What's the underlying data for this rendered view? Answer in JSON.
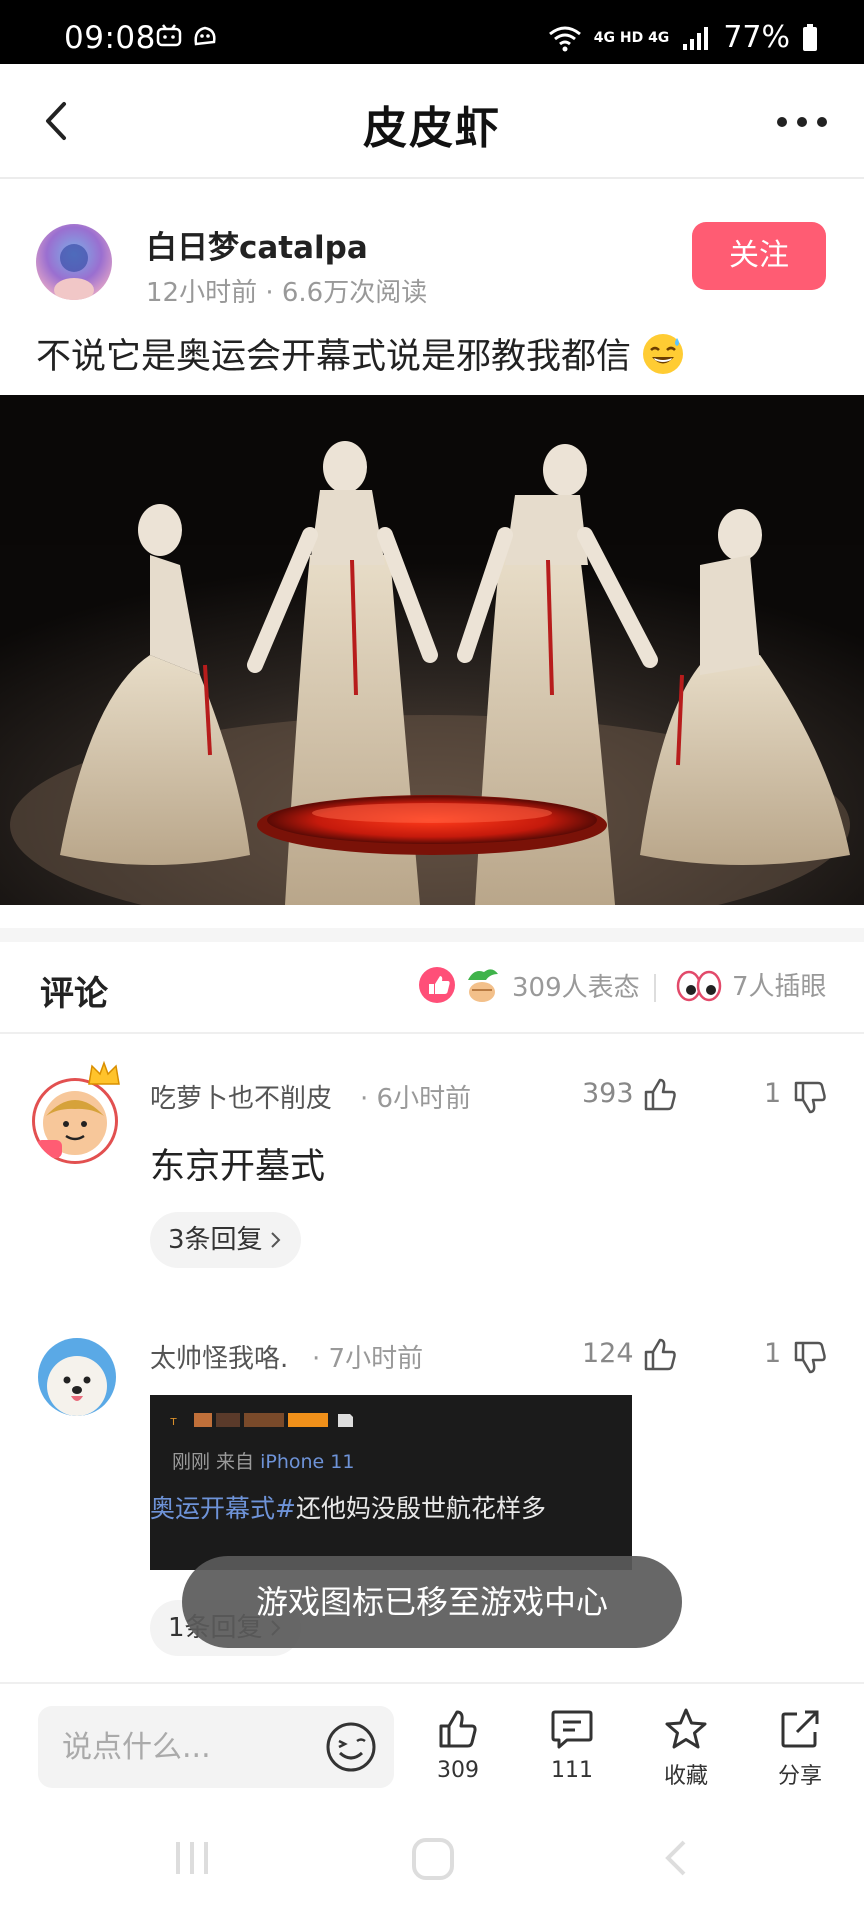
{
  "status_bar": {
    "time": "09:08",
    "net_label": "4G HD 4G",
    "battery": "77%"
  },
  "header": {
    "title": "皮皮虾"
  },
  "post": {
    "author": "白日梦catalpa",
    "meta": "12小时前 · 6.6万次阅读",
    "follow_label": "关注",
    "text": "不说它是奥运会开幕式说是邪教我都信"
  },
  "comments_section": {
    "title": "评论",
    "reactions": "309人表态",
    "eye_count": "7人插眼"
  },
  "comments": [
    {
      "user": "吃萝卜也不削皮",
      "time": "· 6小时前",
      "likes": "393",
      "dislikes": "1",
      "text": "东京开墓式",
      "replies": "3条回复"
    },
    {
      "user": "太帅怪我咯.",
      "time": "· 7小时前",
      "likes": "124",
      "dislikes": "1",
      "replies": "1条回复",
      "screenshot": {
        "sub_prefix": "刚刚  来自",
        "sub_device": "iPhone 11",
        "tag": "奥运开幕式#",
        "text": "还他妈没殷世航花样多"
      }
    }
  ],
  "toast": "游戏图标已移至游戏中心",
  "bottom_bar": {
    "input_placeholder": "说点什么...",
    "like_count": "309",
    "comment_count": "111",
    "favorite_label": "收藏",
    "share_label": "分享"
  },
  "colors": {
    "accent": "#ff5c73",
    "link_blue": "#6e93d8"
  }
}
